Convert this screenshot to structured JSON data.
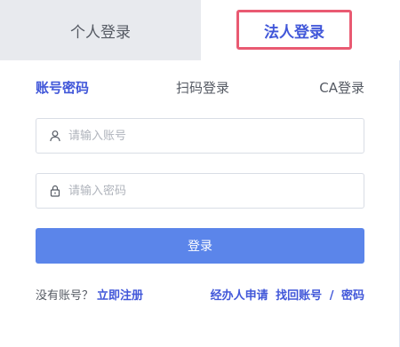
{
  "tabs": {
    "personal_label": "个人登录",
    "corporate_label": "法人登录"
  },
  "subtabs": {
    "account_label": "账号密码",
    "scan_label": "扫码登录",
    "ca_label": "CA登录"
  },
  "form": {
    "account_placeholder": "请输入账号",
    "password_placeholder": "请输入密码",
    "account_value": "",
    "password_value": "",
    "login_label": "登录"
  },
  "footer": {
    "no_account_text": "没有账号？",
    "register_label": "立即注册",
    "agent_apply_label": "经办人申请",
    "find_account_label": "找回账号",
    "separator": "/",
    "password_label": "密码"
  },
  "icons": {
    "user": "user-icon",
    "lock": "lock-icon"
  },
  "colors": {
    "accent": "#4157d9",
    "button": "#5b85ea",
    "highlight_border": "#e95a72",
    "inactive_tab_bg": "#e8eaee"
  }
}
